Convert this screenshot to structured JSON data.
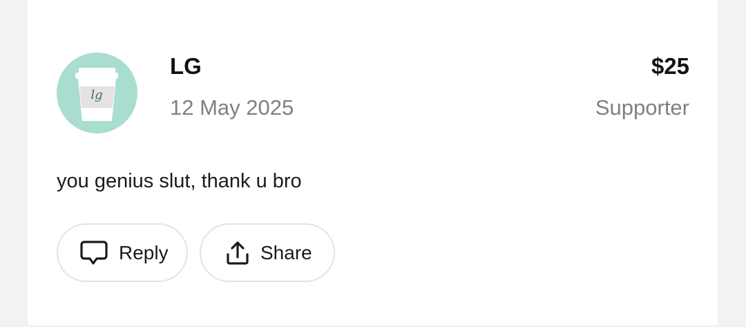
{
  "comment": {
    "author": {
      "name": "LG",
      "avatar_text": "lg",
      "avatar_icon": "coffee-cup-icon"
    },
    "date": "12 May 2025",
    "amount": "$25",
    "tier": "Supporter",
    "message": "you genius slut, thank u bro"
  },
  "actions": {
    "reply": {
      "label": "Reply",
      "icon": "speech-bubble-icon"
    },
    "share": {
      "label": "Share",
      "icon": "share-icon"
    }
  },
  "colors": {
    "background": "#f2f2f2",
    "card": "#ffffff",
    "avatar_bg": "#a9ddd0",
    "primary_text": "#111111",
    "secondary_text": "#808080",
    "button_border": "#e3e3e3"
  }
}
